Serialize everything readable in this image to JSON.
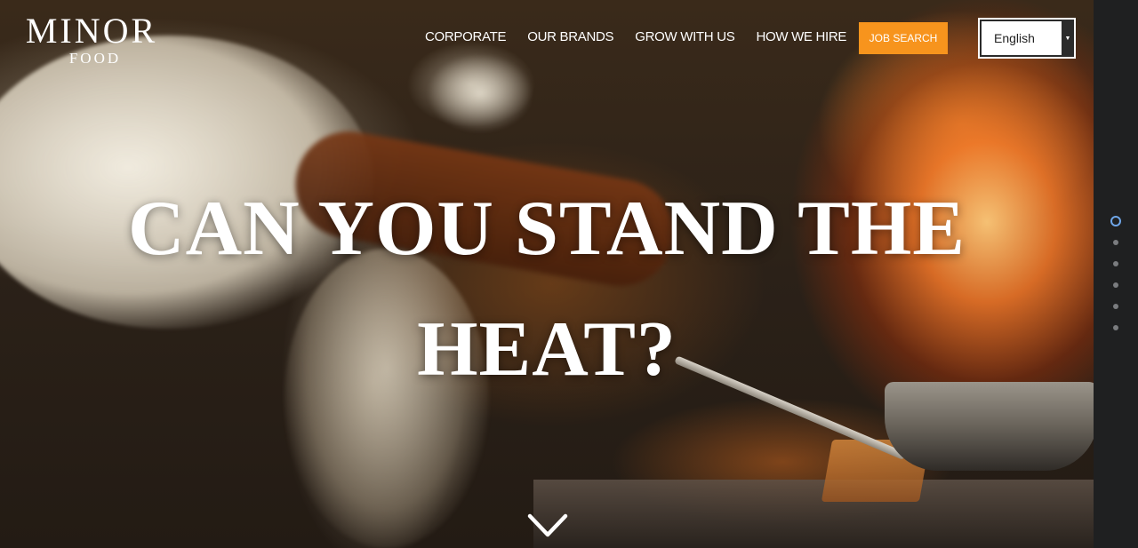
{
  "brand": {
    "name": "MINOR",
    "subname": "FOOD"
  },
  "nav": {
    "items": [
      {
        "label": "CORPORATE"
      },
      {
        "label": "OUR BRANDS"
      },
      {
        "label": "GROW WITH US"
      },
      {
        "label": "HOW WE HIRE"
      }
    ],
    "job_search_label": "JOB SEARCH",
    "language": {
      "selected": "English"
    }
  },
  "hero": {
    "headline_line1": "CAN YOU STAND THE",
    "headline_line2": "HEAT?",
    "scroll_icon": "chevron-down-icon"
  },
  "pagination": {
    "total": 6,
    "active_index": 0,
    "active_color": "#6fa6e8"
  },
  "colors": {
    "accent": "#f7941d",
    "sidebar": "#1f2021"
  }
}
